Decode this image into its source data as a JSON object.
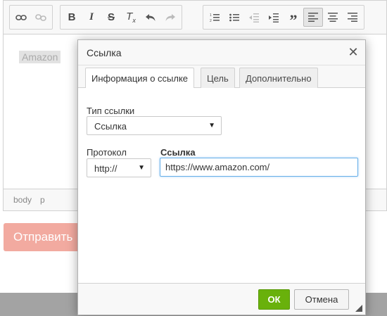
{
  "editor": {
    "toolbar": {
      "groups": [
        [
          {
            "icon": "link-icon",
            "glyph": "🔗",
            "disabled": false
          },
          {
            "icon": "unlink-icon",
            "glyph": "⛓",
            "disabled": true
          }
        ],
        [
          {
            "icon": "bold-icon",
            "glyph": "B"
          },
          {
            "icon": "italic-icon",
            "glyph": "I"
          },
          {
            "icon": "strike-icon",
            "glyph": "S"
          },
          {
            "icon": "remove-format-icon",
            "glyph": "Tₓ"
          },
          {
            "icon": "undo-icon",
            "glyph": "↶"
          },
          {
            "icon": "redo-icon",
            "glyph": "↷",
            "disabled": true
          }
        ],
        [
          {
            "icon": "numbered-list-icon",
            "glyph": "≔"
          },
          {
            "icon": "bulleted-list-icon",
            "glyph": "☰"
          },
          {
            "icon": "outdent-icon",
            "glyph": "⇤",
            "disabled": true
          },
          {
            "icon": "indent-icon",
            "glyph": "⇥"
          },
          {
            "icon": "blockquote-icon",
            "glyph": "❞"
          },
          {
            "icon": "align-left-icon",
            "glyph": "≡",
            "active": true
          },
          {
            "icon": "align-center-icon",
            "glyph": "≡"
          },
          {
            "icon": "align-right-icon",
            "glyph": "≡"
          }
        ]
      ]
    },
    "content_text": "Amazon",
    "status_path": [
      "body",
      "p"
    ]
  },
  "submit_label": "Отправить",
  "dialog": {
    "title": "Ссылка",
    "tabs": [
      {
        "label": "Информация о ссылке",
        "active": true
      },
      {
        "label": "Цель",
        "active": false
      },
      {
        "label": "Дополнительно",
        "active": false
      }
    ],
    "link_type_label": "Тип ссылки",
    "link_type_value": "Ссылка",
    "protocol_label": "Протокол",
    "protocol_value": "http://",
    "url_label": "Ссылка",
    "url_value": "https://www.amazon.com/",
    "ok_label": "ОК",
    "cancel_label": "Отмена"
  },
  "colors": {
    "ok_button": "#69b10b",
    "submit_button": "#f2aaa0",
    "focus_border": "#66afe9"
  }
}
